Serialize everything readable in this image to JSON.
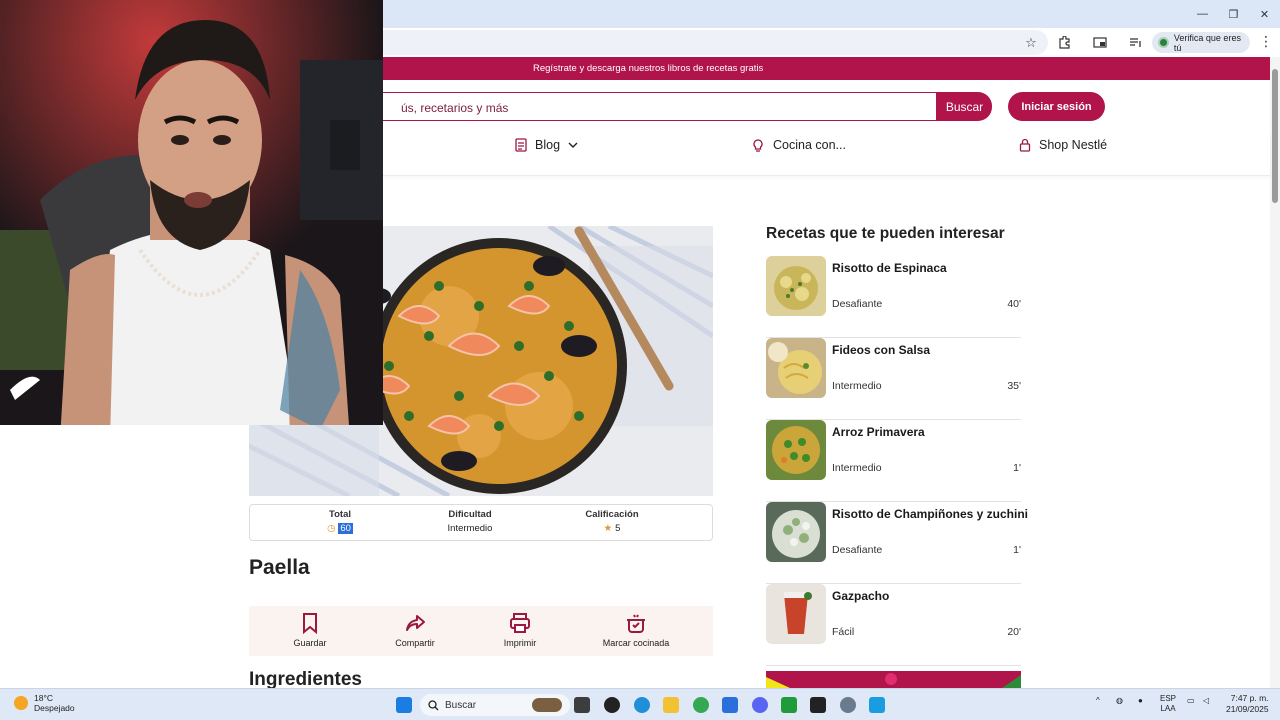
{
  "browser": {
    "window_controls": [
      "—",
      "❐",
      "✕"
    ],
    "verify_label": "Verifica que eres tú"
  },
  "site": {
    "promo_text": "Regístrate y descarga nuestros libros de recetas gratis",
    "search": {
      "placeholder": "ús, recetarios y más",
      "button": "Buscar"
    },
    "login_button": "Iniciar sesión",
    "nav": [
      {
        "label": "Blog",
        "icon": "document-icon"
      },
      {
        "label": "Cocina con...",
        "icon": "bulb-icon"
      },
      {
        "label": "Shop Nestlé",
        "icon": "lock-icon"
      }
    ]
  },
  "recipe": {
    "title": "Paella",
    "info": [
      {
        "label": "Total",
        "value": "60"
      },
      {
        "label": "Dificultad",
        "value": "Intermedio"
      },
      {
        "label": "Calificación",
        "value": "5"
      }
    ],
    "actions": [
      {
        "label": "Guardar"
      },
      {
        "label": "Compartir"
      },
      {
        "label": "Imprimir"
      },
      {
        "label": "Marcar cocinada"
      }
    ],
    "section_heading": "Ingredientes"
  },
  "sidebar": {
    "title": "Recetas que te pueden interesar",
    "recipes": [
      {
        "name": "Risotto de Espinaca",
        "difficulty": "Desafiante",
        "time": "40'"
      },
      {
        "name": "Fideos con Salsa",
        "difficulty": "Intermedio",
        "time": "35'"
      },
      {
        "name": "Arroz Primavera",
        "difficulty": "Intermedio",
        "time": "1'"
      },
      {
        "name": "Risotto de Champiñones y zuchini",
        "difficulty": "Desafiante",
        "time": "1'"
      },
      {
        "name": "Gazpacho",
        "difficulty": "Fácil",
        "time": "20'"
      }
    ]
  },
  "taskbar": {
    "weather_temp": "18°C",
    "weather_desc": "Despejado",
    "search_label": "Buscar",
    "lang_1": "ESP",
    "lang_2": "LAA",
    "time": "7:47 p. m.",
    "date": "21/09/2025"
  },
  "colors": {
    "brand": "#b0144a",
    "action_bg": "#fbf3ef"
  }
}
